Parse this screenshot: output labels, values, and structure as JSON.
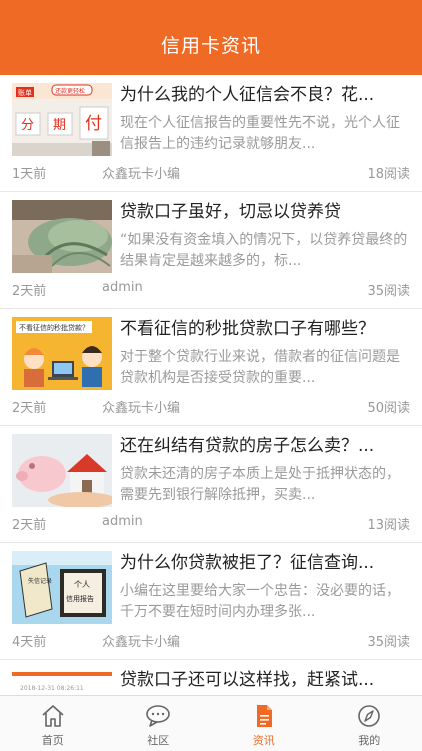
{
  "header": {
    "title": "信用卡资讯"
  },
  "articles": [
    {
      "title": "为什么我的个人征信会不良？花...",
      "summary": "现在个人征信报告的重要性先不说，光个人征信报告上的违约记录就够朋友...",
      "age": "1天前",
      "author": "众鑫玩卡小编",
      "reads": "18阅读"
    },
    {
      "title": "贷款口子虽好，切忌以贷养贷",
      "summary": "“如果没有资金填入的情况下，以贷养贷最终的结果肯定是越来越多的，标...",
      "age": "2天前",
      "author": "admin",
      "reads": "35阅读"
    },
    {
      "title": "不看征信的秒批贷款口子有哪些？",
      "summary": "对于整个贷款行业来说，借款者的征信问题是贷款机构是否接受贷款的重要...",
      "age": "2天前",
      "author": "众鑫玩卡小编",
      "reads": "50阅读"
    },
    {
      "title": "还在纠结有贷款的房子怎么卖？...",
      "summary": "贷款未还清的房子本质上是处于抵押状态的，需要先到银行解除抵押，买卖...",
      "age": "2天前",
      "author": "admin",
      "reads": "13阅读"
    },
    {
      "title": "为什么你贷款被拒了？征信查询...",
      "summary": "小编在这里要给大家一个忠告：没必要的话，千万不要在短时间内办理多张...",
      "age": "4天前",
      "author": "众鑫玩卡小编",
      "reads": "35阅读"
    },
    {
      "title": "贷款口子还可以这样找，赶紧试...",
      "summary": "",
      "age": "",
      "author": "",
      "reads": ""
    }
  ],
  "thumbs": {
    "t1": {
      "tag1": "账单",
      "tag2": "还款更轻松",
      "c1": "分",
      "c2": "期",
      "c3": "付"
    },
    "t3": {
      "label": "不看征信的秒批贷款？"
    },
    "t5": {
      "label1": "个人",
      "label2": "信用报告",
      "side": "失信记录"
    },
    "t6": {
      "date": "2018-12-31 08:26:11"
    }
  },
  "tabbar": [
    {
      "label": "首页",
      "icon": "home-icon",
      "active": false
    },
    {
      "label": "社区",
      "icon": "chat-icon",
      "active": false
    },
    {
      "label": "资讯",
      "icon": "document-icon",
      "active": true
    },
    {
      "label": "我的",
      "icon": "compass-icon",
      "active": false
    }
  ],
  "colors": {
    "accent": "#ef6b25",
    "text": "#222222",
    "muted": "#9a9a9a"
  }
}
